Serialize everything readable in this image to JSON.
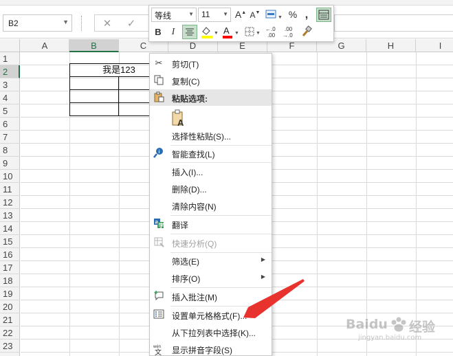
{
  "formula_bar": {
    "name_box": "B2",
    "cancel_glyph": "✕",
    "enter_glyph": "✓",
    "formula_value": ""
  },
  "columns": [
    "A",
    "B",
    "C",
    "D",
    "E",
    "F",
    "G",
    "H",
    "I"
  ],
  "rows": [
    "1",
    "2",
    "3",
    "4",
    "5",
    "6",
    "7",
    "8",
    "9",
    "10",
    "11",
    "12",
    "13",
    "14",
    "15",
    "16",
    "17",
    "18",
    "19",
    "20",
    "21",
    "22",
    "23"
  ],
  "selected": {
    "column": "B",
    "row": "2"
  },
  "cells": {
    "B2": "我是123"
  },
  "mini_toolbar": {
    "font_name": "等线",
    "font_size": "11",
    "increase_font_label": "A",
    "decrease_font_label": "A",
    "bold_label": "B",
    "italic_label": "I",
    "percent_label": "%",
    "comma_label": ",",
    "font_color_label": "A",
    "increase_decimal_label": "←.0\n.00",
    "decrease_decimal_label": ".00\n→.0",
    "fill_color": "#ffff00",
    "font_color": "#ff0000"
  },
  "context_menu": {
    "items": [
      {
        "label": "剪切(T)",
        "icon": "scissors-icon"
      },
      {
        "label": "复制(C)",
        "icon": "copy-icon"
      },
      {
        "label": "粘贴选项:",
        "icon": "paste-icon",
        "header": true
      },
      {
        "label": "选择性粘贴(S)...",
        "icon": ""
      },
      {
        "label": "智能查找(L)",
        "icon": "smart-lookup-icon"
      },
      {
        "label": "插入(I)...",
        "icon": ""
      },
      {
        "label": "删除(D)...",
        "icon": ""
      },
      {
        "label": "清除内容(N)",
        "icon": ""
      },
      {
        "label": "翻译",
        "icon": "translate-icon"
      },
      {
        "label": "快速分析(Q)",
        "icon": "quick-analysis-icon",
        "disabled": true
      },
      {
        "label": "筛选(E)",
        "icon": "",
        "submenu": true
      },
      {
        "label": "排序(O)",
        "icon": "",
        "submenu": true
      },
      {
        "label": "插入批注(M)",
        "icon": "insert-comment-icon"
      },
      {
        "label": "设置单元格格式(F)...",
        "icon": "format-cells-icon"
      },
      {
        "label": "从下拉列表中选择(K)...",
        "icon": ""
      },
      {
        "label": "显示拼音字段(S)",
        "icon": "phonetic-icon"
      }
    ],
    "paste_option_glyph": "A"
  },
  "annotation": {
    "arrow_color": "#e8322e"
  },
  "watermark": {
    "brand": "Baidu",
    "cn": "经验",
    "sub": "jingyan.baidu.com"
  },
  "colors": {
    "excel_green": "#217346",
    "header_bg": "#f3f3f3"
  }
}
